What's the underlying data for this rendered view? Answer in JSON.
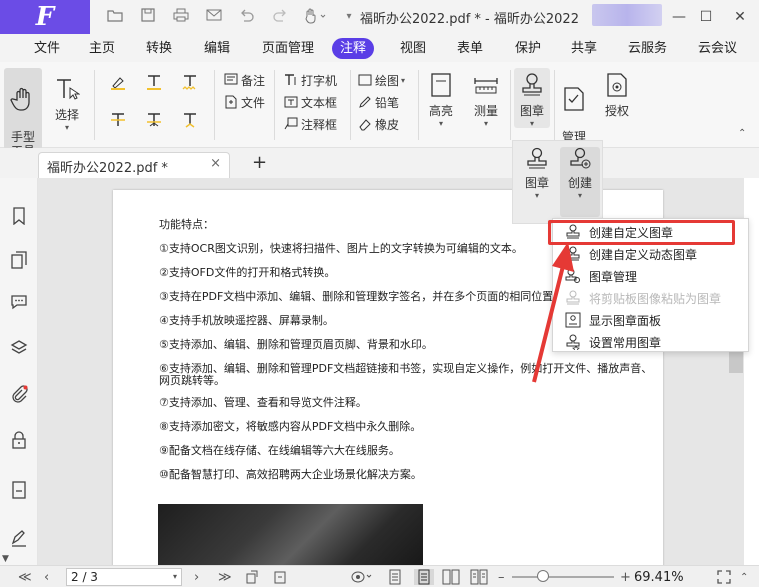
{
  "window": {
    "title": "福昕办公2022.pdf * - 福昕办公2022",
    "logo_letter": "F"
  },
  "menu": {
    "items": [
      "文件",
      "主页",
      "转换",
      "编辑",
      "页面管理",
      "注释",
      "视图",
      "表单",
      "保护",
      "共享",
      "云服务",
      "云会议"
    ],
    "active": "注释"
  },
  "ribbon": {
    "hand_tool": "手型\n工具",
    "select": "选择",
    "note": "备注",
    "file": "文件",
    "typewriter": "打字机",
    "textbox": "文本框",
    "callout": "注释框",
    "drawing": "绘图",
    "pencil": "铅笔",
    "eraser": "橡皮",
    "highlight": "高亮",
    "measure": "测量",
    "stamp": "图章",
    "manage_comments": "管理\n注释",
    "authorize": "授权"
  },
  "tabs": {
    "doc_tab": "福昕办公2022.pdf *",
    "close": "×",
    "new_tab": "+"
  },
  "stamp_panel": {
    "stamp": "图章",
    "create": "创建"
  },
  "dropdown": {
    "items": [
      {
        "label": "创建自定义图章",
        "disabled": false
      },
      {
        "label": "创建自定义动态图章",
        "disabled": false
      },
      {
        "label": "图章管理",
        "disabled": false
      },
      {
        "label": "将剪贴板图像粘贴为图章",
        "disabled": true
      },
      {
        "label": "显示图章面板",
        "disabled": false
      },
      {
        "label": "设置常用图章",
        "disabled": false
      }
    ]
  },
  "document": {
    "heading": "功能特点：",
    "lines": [
      "①支持OCR图文识别，快速将扫描件、图片上的文字转换为可编辑的文本。",
      "②支持OFD文件的打开和格式转换。",
      "③支持在PDF文档中添加、编辑、删除和管理数字签名，并在多个页面的相同位置",
      "④支持手机放映遥控器、屏幕录制。",
      "⑤支持添加、编辑、删除和管理页眉页脚、背景和水印。",
      "⑥支持添加、编辑、删除和管理PDF文档超链接和书签，实现自定义操作，例如打开文件、播放声音、",
      "网页跳转等。",
      "⑦支持添加、管理、查看和导览文件注释。",
      "⑧支持添加密文，将敏感内容从PDF文档中永久删除。",
      "⑨配备文档在线存储、在线编辑等六大在线服务。",
      "⑩配备智慧打印、高效招聘两大企业场景化解决方案。"
    ]
  },
  "status": {
    "page": "2 / 3",
    "zoom": "69.41%",
    "zoom_level_percent": 69.41
  }
}
